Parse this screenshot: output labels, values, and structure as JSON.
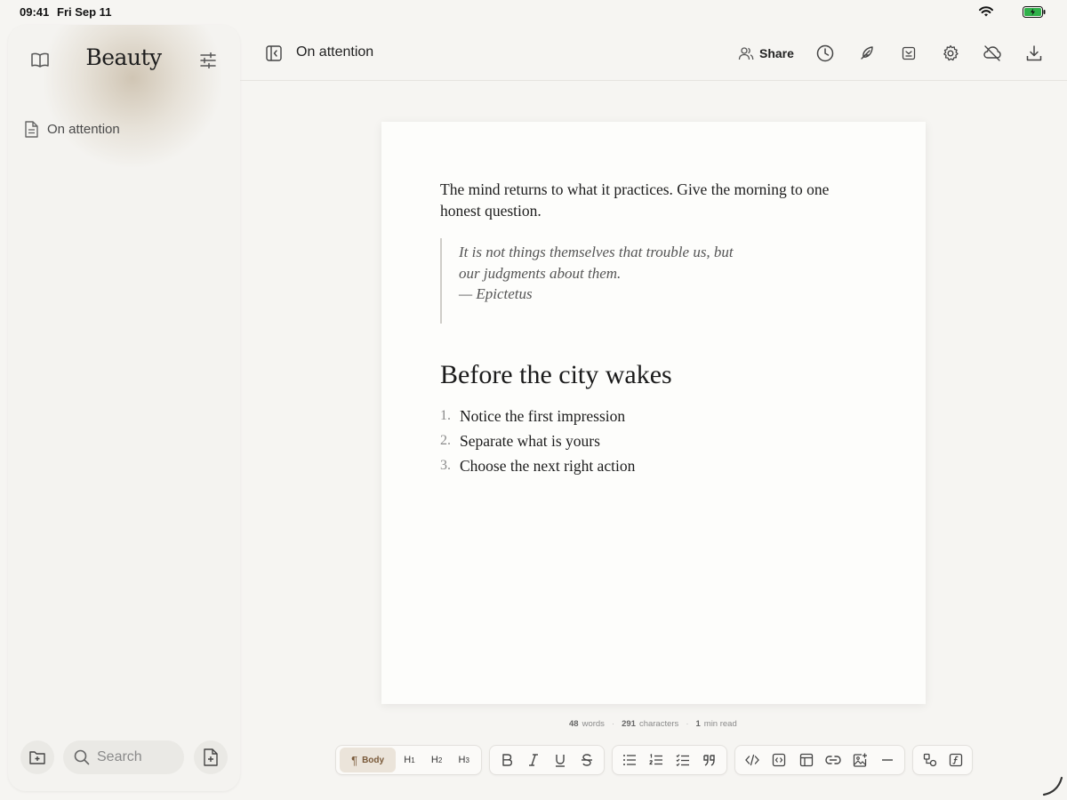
{
  "status_bar": {
    "time": "09:41",
    "date": "Fri Sep 11"
  },
  "sidebar": {
    "app_title": "Beauty",
    "documents": [
      {
        "label": "On attention"
      }
    ],
    "search": {
      "placeholder": "Search"
    }
  },
  "header": {
    "doc_title": "On attention",
    "share_label": "Share",
    "icons": [
      "history-icon",
      "feather-icon",
      "inbox-icon",
      "gear-icon",
      "cloud-off-icon",
      "download-icon"
    ]
  },
  "document": {
    "paragraph": "The mind returns to what it practices. Give the morning to one honest question.",
    "quote_lines": [
      "It is not things themselves that trouble us, but",
      "our judgments about them.",
      "— Epictetus"
    ],
    "heading": "Before the city wakes",
    "list": [
      {
        "number": "1.",
        "text": "Notice the first impression"
      },
      {
        "number": "2.",
        "text": "Separate what is yours"
      },
      {
        "number": "3.",
        "text": "Choose the next right action"
      }
    ]
  },
  "stats": {
    "words_value": "48",
    "words_label": "words",
    "chars_value": "291",
    "chars_label": "characters",
    "read_value": "1",
    "read_label": "min read"
  },
  "toolbar": {
    "body_label": "Body",
    "h1": "H",
    "h1_sub": "1",
    "h2": "H",
    "h2_sub": "2",
    "h3": "H",
    "h3_sub": "3"
  },
  "colors": {
    "background": "#f6f5f2",
    "page": "#fdfdfb",
    "accent_body": "#ebe4da",
    "accent_text": "#7a5a3a"
  }
}
